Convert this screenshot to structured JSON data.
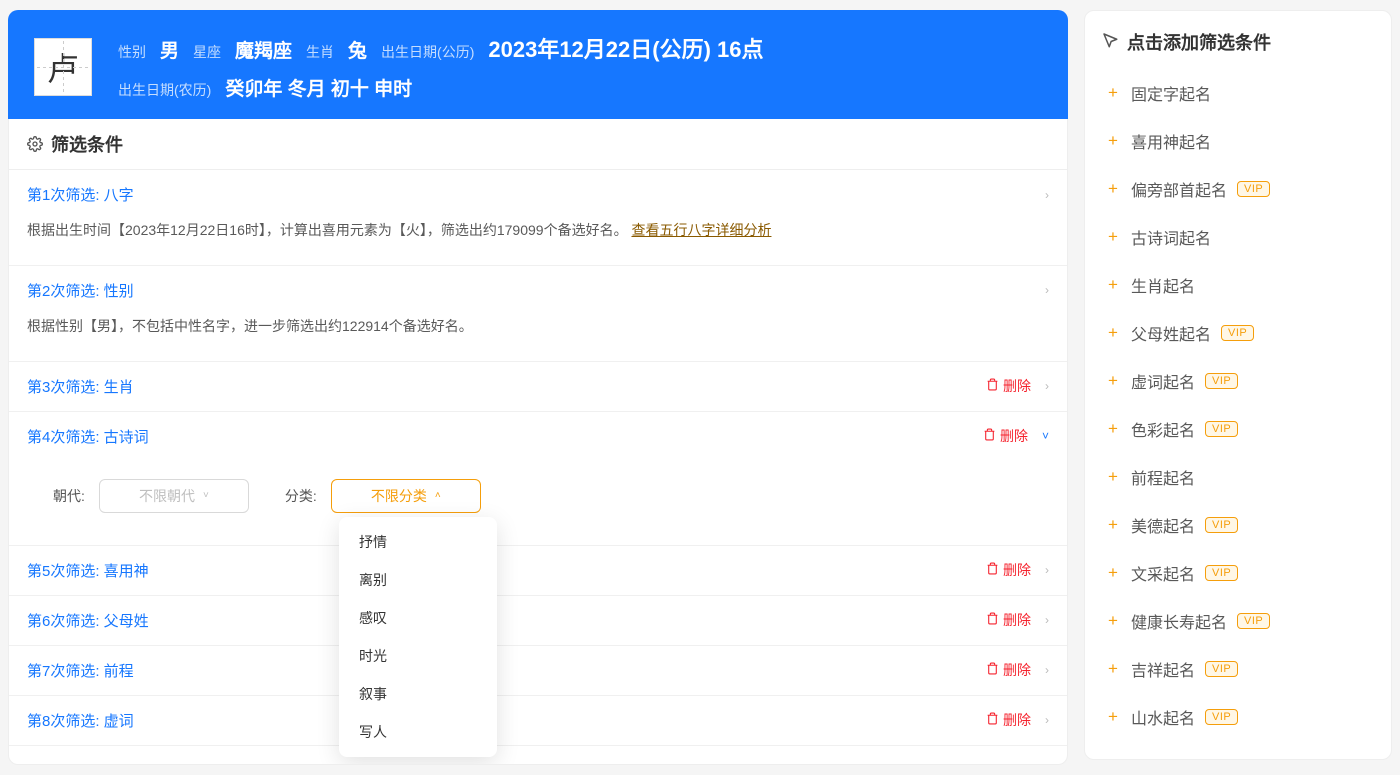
{
  "header": {
    "surname": "卢",
    "gender_label": "性别",
    "gender": "男",
    "constellation_label": "星座",
    "constellation": "魔羯座",
    "zodiac_label": "生肖",
    "zodiac": "兔",
    "birth_solar_label": "出生日期(公历)",
    "birth_solar": "2023年12月22日(公历) 16点",
    "birth_lunar_label": "出生日期(农历)",
    "birth_lunar": "癸卯年 冬月 初十 申时"
  },
  "panel": {
    "title": "筛选条件"
  },
  "delete_label": "删除",
  "filters": [
    {
      "title": "第1次筛选: 八字",
      "expanded": true,
      "deletable": false,
      "body_pre": "根据出生时间【2023年12月22日16时】，计算出喜用元素为【火】，筛选出约179099个备选好名。",
      "link": "查看五行八字详细分析"
    },
    {
      "title": "第2次筛选: 性别",
      "expanded": true,
      "deletable": false,
      "body_pre": "根据性别【男】，不包括中性名字，进一步筛选出约122914个备选好名。",
      "link": ""
    },
    {
      "title": "第3次筛选: 生肖",
      "expanded": false,
      "deletable": true
    },
    {
      "title": "第4次筛选: 古诗词",
      "expanded": true,
      "deletable": true,
      "poem_controls": true
    },
    {
      "title": "第5次筛选: 喜用神",
      "expanded": false,
      "deletable": true
    },
    {
      "title": "第6次筛选: 父母姓",
      "expanded": false,
      "deletable": true
    },
    {
      "title": "第7次筛选: 前程",
      "expanded": false,
      "deletable": true
    },
    {
      "title": "第8次筛选: 虚词",
      "expanded": false,
      "deletable": true
    }
  ],
  "poem": {
    "dynasty_label": "朝代:",
    "dynasty_placeholder": "不限朝代",
    "category_label": "分类:",
    "category_placeholder": "不限分类",
    "options": [
      "抒情",
      "离别",
      "感叹",
      "时光",
      "叙事",
      "写人"
    ]
  },
  "sidebar": {
    "title": "点击添加筛选条件",
    "items": [
      {
        "label": "固定字起名",
        "vip": false
      },
      {
        "label": "喜用神起名",
        "vip": false
      },
      {
        "label": "偏旁部首起名",
        "vip": true
      },
      {
        "label": "古诗词起名",
        "vip": false
      },
      {
        "label": "生肖起名",
        "vip": false
      },
      {
        "label": "父母姓起名",
        "vip": true
      },
      {
        "label": "虚词起名",
        "vip": true
      },
      {
        "label": "色彩起名",
        "vip": true
      },
      {
        "label": "前程起名",
        "vip": false
      },
      {
        "label": "美德起名",
        "vip": true
      },
      {
        "label": "文采起名",
        "vip": true
      },
      {
        "label": "健康长寿起名",
        "vip": true
      },
      {
        "label": "吉祥起名",
        "vip": true
      },
      {
        "label": "山水起名",
        "vip": true
      }
    ],
    "vip_text": "VIP"
  }
}
